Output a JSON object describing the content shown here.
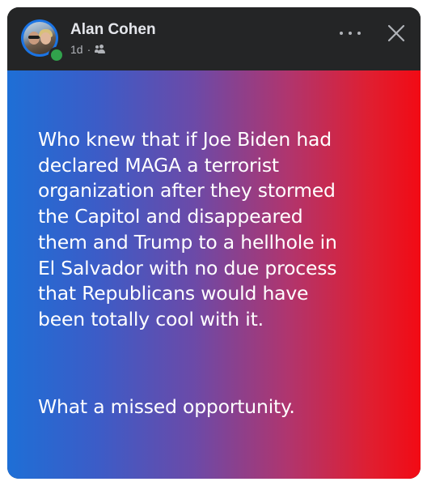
{
  "post": {
    "author_name": "Alan Cohen",
    "timestamp": "1d",
    "separator": "·",
    "audience_icon": "friends-icon",
    "more_icon": "more-horizontal-icon",
    "close_icon": "close-icon",
    "online_status_color": "#31a24c",
    "body_paragraph_1": "Who knew that if Joe Biden had\ndeclared MAGA a terrorist\norganization after they stormed\nthe Capitol and disappeared\nthem and Trump to a hellhole in\nEl Salvador with no due process\nthat Republicans would have\nbeen totally cool with it.",
    "body_paragraph_2": "What a missed opportunity.",
    "background_gradient": [
      "#1e6fd6",
      "#6b4aa8",
      "#f20a14"
    ]
  }
}
